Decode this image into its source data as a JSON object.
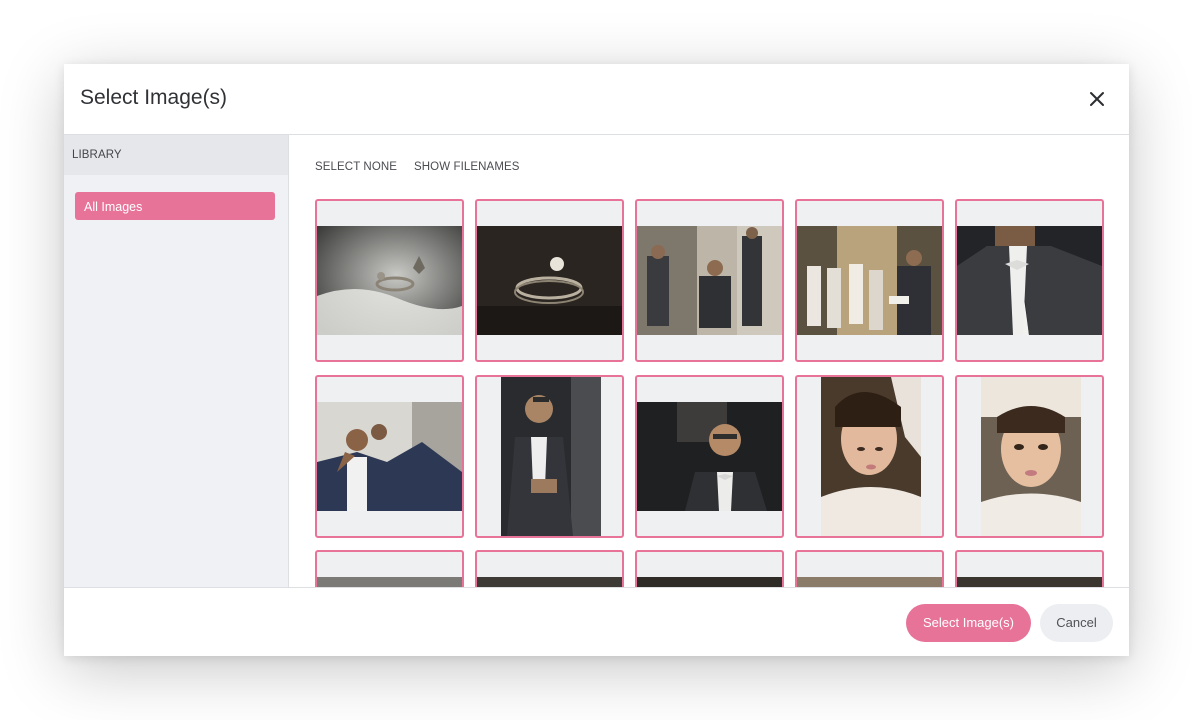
{
  "modal": {
    "title": "Select Image(s)",
    "close_icon": "close-icon"
  },
  "sidebar": {
    "header": "LIBRARY",
    "items": [
      {
        "label": "All Images",
        "active": true
      }
    ]
  },
  "toolbar": {
    "select_none": "SELECT NONE",
    "show_filenames": "SHOW FILENAMES"
  },
  "footer": {
    "primary_label": "Select Image(s)",
    "cancel_label": "Cancel"
  },
  "colors": {
    "accent": "#e77399",
    "selected_border": "#e77399",
    "sidebar_bg": "#f0f1f4"
  },
  "images": [
    {
      "subject": "fleur-de-lis ring on fabric",
      "orientation": "landscape",
      "selected": true
    },
    {
      "subject": "wedding rings on dark surface",
      "orientation": "landscape",
      "selected": true
    },
    {
      "subject": "groomsmen seated in room",
      "orientation": "landscape",
      "selected": true
    },
    {
      "subject": "men getting ready in hotel room",
      "orientation": "landscape",
      "selected": true
    },
    {
      "subject": "groom bow tie close-up",
      "orientation": "landscape",
      "selected": true
    },
    {
      "subject": "groom being helped with jacket",
      "orientation": "landscape",
      "selected": true
    },
    {
      "subject": "groom adjusting cufflink",
      "orientation": "portrait",
      "selected": true
    },
    {
      "subject": "groom portrait by window",
      "orientation": "landscape",
      "selected": true
    },
    {
      "subject": "flower girl looking down",
      "orientation": "portrait",
      "selected": true
    },
    {
      "subject": "flower girl portrait",
      "orientation": "portrait",
      "selected": true
    },
    {
      "subject": "",
      "orientation": "landscape",
      "selected": true
    },
    {
      "subject": "",
      "orientation": "landscape",
      "selected": true
    },
    {
      "subject": "",
      "orientation": "landscape",
      "selected": true
    },
    {
      "subject": "",
      "orientation": "landscape",
      "selected": true
    },
    {
      "subject": "",
      "orientation": "landscape",
      "selected": true
    }
  ]
}
